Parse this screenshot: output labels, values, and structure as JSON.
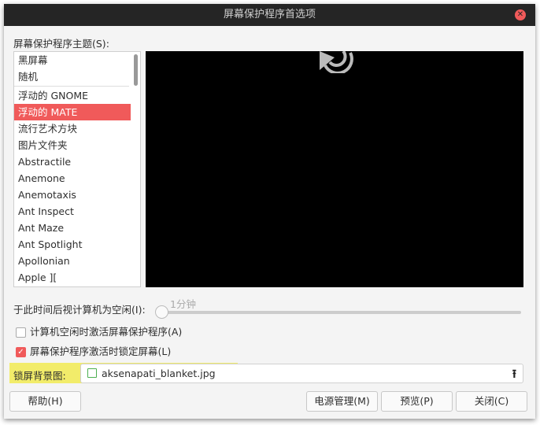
{
  "window": {
    "title": "屏幕保护程序首选项"
  },
  "theme_label": "屏幕保护程序主题(S):",
  "themes_top": [
    "黑屏幕",
    "随机"
  ],
  "themes": [
    "浮动的 GNOME",
    "浮动的 MATE",
    "流行艺术方块",
    "图片文件夹",
    "Abstractile",
    "Anemone",
    "Anemotaxis",
    "Ant Inspect",
    "Ant Maze",
    "Ant Spotlight",
    "Apollonian",
    "Apple ]["
  ],
  "selected_theme": "浮动的 MATE",
  "idle": {
    "label": "于此时间后视计算机为空闲(I):",
    "value_text": "1分钟",
    "fraction": 0
  },
  "activate": {
    "label": "计算机空闲时激活屏幕保护程序(A)",
    "checked": false
  },
  "lock": {
    "label": "屏幕保护程序激活时锁定屏幕(L)",
    "checked": true
  },
  "background": {
    "label": "锁屏背景图:",
    "file": "aksenapati_blanket.jpg"
  },
  "buttons": {
    "help": "帮助(H)",
    "power": "电源管理(M)",
    "preview": "预览(P)",
    "close": "关闭(C)"
  },
  "colors": {
    "accent": "#f05a5a",
    "highlight": "#f2ec6a"
  }
}
